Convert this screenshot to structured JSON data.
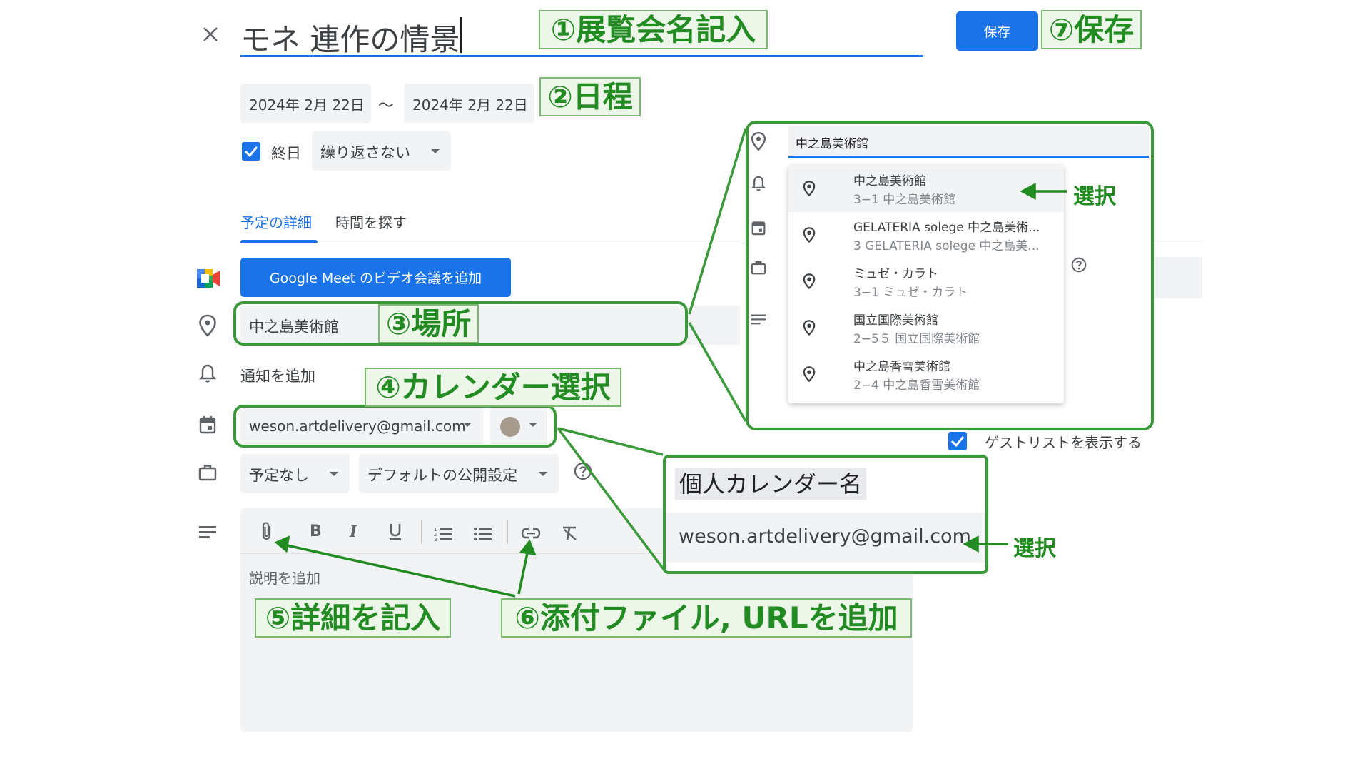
{
  "header": {
    "title": "モネ 連作の情景",
    "save_label": "保存"
  },
  "dates": {
    "start": "2024年 2月 22日",
    "separator": "～",
    "end": "2024年 2月 22日"
  },
  "options": {
    "all_day_label": "終日",
    "all_day_checked": true,
    "repeat_value": "繰り返さない"
  },
  "tabs": {
    "details": "予定の詳細",
    "find_time": "時間を探す"
  },
  "meet_button": "Google Meet のビデオ会議を追加",
  "location": {
    "value": "中之島美術館"
  },
  "notification": "通知を追加",
  "calendar": {
    "account": "weson.artdelivery@gmail.com"
  },
  "availability": {
    "busy": "予定なし",
    "visibility": "デフォルトの公開設定"
  },
  "description": {
    "placeholder": "説明を追加"
  },
  "location_popup": {
    "input": "中之島美術館",
    "suggestions": [
      {
        "name": "中之島美術館",
        "address": "3−1 中之島美術館"
      },
      {
        "name": "GELATERIA solege 中之島美術...",
        "address": "3 GELATERIA solege 中之島美..."
      },
      {
        "name": "ミュゼ・カラト",
        "address": "3−1 ミュゼ・カラト"
      },
      {
        "name": "国立国際美術館",
        "address": "2−5５ 国立国際美術館"
      },
      {
        "name": "中之島香雪美術館",
        "address": "2−4 中之島香雪美術館"
      }
    ],
    "background_option": "ゲストリストを表示する"
  },
  "calendar_popup": {
    "title": "個人カレンダー名",
    "account": "weson.artdelivery@gmail.com"
  },
  "annotations": {
    "step1": "①展覧会名記入",
    "step2": "②日程",
    "step3": "③場所",
    "step4": "④カレンダー選択",
    "step5": "⑤詳細を記入",
    "step6": "⑥添付ファイル, URLを追加",
    "step7": "⑦保存",
    "select_location": "選択",
    "select_calendar": "選択"
  },
  "colors": {
    "accent_blue": "#1a73e8",
    "annotation_green": "#228b22",
    "frame_green": "#3a9a3a",
    "calendar_color": "#a79b8e"
  }
}
